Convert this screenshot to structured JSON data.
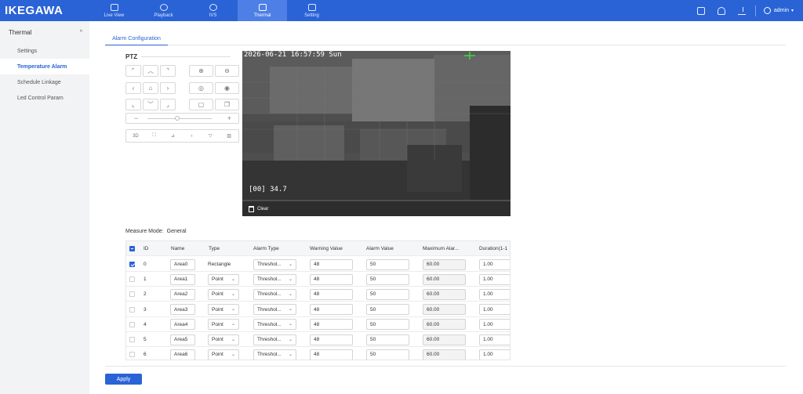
{
  "app": {
    "logo": "IKEGAWA"
  },
  "nav": {
    "tabs": [
      {
        "label": "Live View",
        "icon": "live-view-icon"
      },
      {
        "label": "Playback",
        "icon": "playback-icon"
      },
      {
        "label": "IVS",
        "icon": "ivs-icon"
      },
      {
        "label": "Thermal",
        "icon": "thermal-icon",
        "active": true
      },
      {
        "label": "Setting",
        "icon": "setting-icon"
      }
    ],
    "user": "admin"
  },
  "sidebar": {
    "group": "Thermal",
    "items": [
      {
        "label": "Settings"
      },
      {
        "label": "Temperature Alarm",
        "active": true
      },
      {
        "label": "Schedule Linkage"
      },
      {
        "label": "Led Control Param"
      }
    ]
  },
  "main": {
    "tab": "Alarm Configuration",
    "ptz": {
      "title": "PTZ",
      "tools": [
        "3D"
      ]
    },
    "video": {
      "timestamp": "2026-06-21 16:57:59 Sun",
      "readout": "[00] 34.7",
      "clear_label": "Clear"
    },
    "measure": {
      "label": "Measure Mode:",
      "value": "General"
    },
    "table": {
      "headers": [
        "ID",
        "Name",
        "Type",
        "Alarm Type",
        "Warning Value",
        "Alarm Value",
        "Maximum Alar...",
        "Duration(1-1"
      ],
      "rows": [
        {
          "id": "0",
          "name": "Area0",
          "type": "Rectangle",
          "type_editable": false,
          "alarm_type": "Threshol...",
          "warning": "48",
          "alarm": "50",
          "maximum": "60.00",
          "duration": "1.00",
          "checked": true
        },
        {
          "id": "1",
          "name": "Area1",
          "type": "Point",
          "type_editable": true,
          "alarm_type": "Threshol...",
          "warning": "48",
          "alarm": "50",
          "maximum": "60.00",
          "duration": "1.00",
          "checked": false
        },
        {
          "id": "2",
          "name": "Area2",
          "type": "Point",
          "type_editable": true,
          "alarm_type": "Threshol...",
          "warning": "48",
          "alarm": "50",
          "maximum": "60.00",
          "duration": "1.00",
          "checked": false
        },
        {
          "id": "3",
          "name": "Area3",
          "type": "Point",
          "type_editable": true,
          "alarm_type": "Threshol...",
          "warning": "48",
          "alarm": "50",
          "maximum": "60.00",
          "duration": "1.00",
          "checked": false
        },
        {
          "id": "4",
          "name": "Area4",
          "type": "Point",
          "type_editable": true,
          "alarm_type": "Threshol...",
          "warning": "48",
          "alarm": "50",
          "maximum": "60.00",
          "duration": "1.00",
          "checked": false
        },
        {
          "id": "5",
          "name": "Area5",
          "type": "Point",
          "type_editable": true,
          "alarm_type": "Threshol...",
          "warning": "48",
          "alarm": "50",
          "maximum": "60.00",
          "duration": "1.00",
          "checked": false
        },
        {
          "id": "6",
          "name": "Area6",
          "type": "Point",
          "type_editable": true,
          "alarm_type": "Threshol...",
          "warning": "48",
          "alarm": "50",
          "maximum": "60.00",
          "duration": "1.00",
          "checked": false
        }
      ]
    },
    "apply_label": "Apply"
  },
  "colors": {
    "primary": "#2a63d6",
    "sidebar_bg": "#f2f3f5"
  }
}
